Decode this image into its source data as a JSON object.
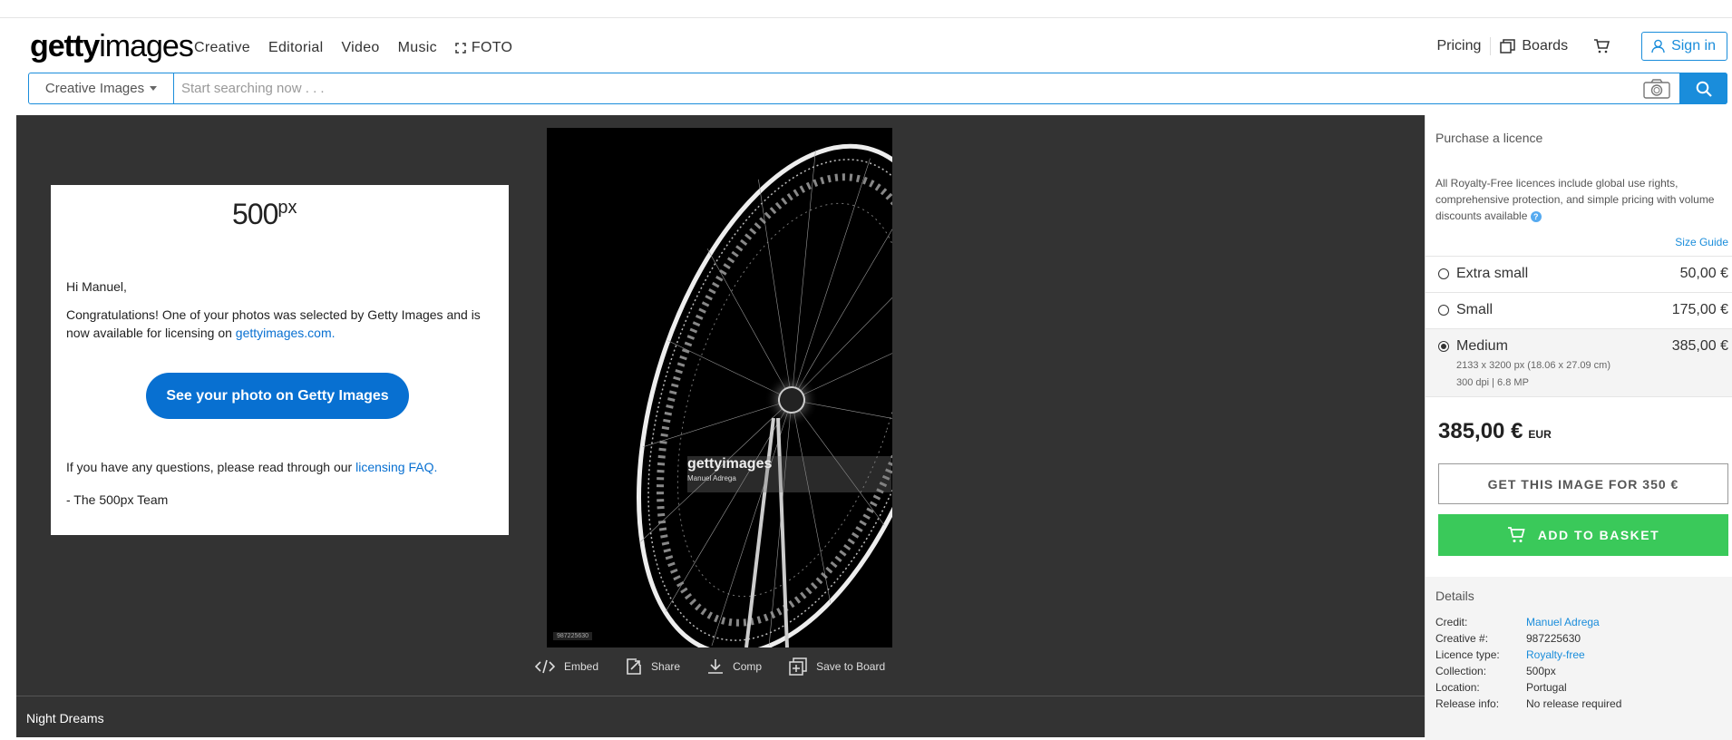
{
  "header": {
    "logo_bold": "getty",
    "logo_light": "images",
    "nav": [
      "Creative",
      "Editorial",
      "Video",
      "Music",
      "FOTO"
    ],
    "pricing": "Pricing",
    "boards": "Boards",
    "sign_in": "Sign in"
  },
  "search": {
    "type": "Creative Images",
    "placeholder": "Start searching now . . ."
  },
  "email": {
    "logo": "500",
    "logo_sup": "px",
    "greeting": "Hi Manuel,",
    "body_1": "Congratulations! One of your photos was selected by Getty Images and is now available for licensing on ",
    "body_link": "gettyimages.com.",
    "button": "See your photo on Getty Images",
    "questions": "If you have any questions, please read through our ",
    "questions_link": "licensing FAQ.",
    "signature": "- The 500px Team"
  },
  "photo": {
    "id": "987225630",
    "watermark_logo": "gettyimages",
    "watermark_name": "Manuel Adrega"
  },
  "actions": {
    "embed": "Embed",
    "share": "Share",
    "comp": "Comp",
    "save": "Save to Board"
  },
  "image_title": "Night Dreams",
  "sidebar": {
    "title": "Purchase a licence",
    "description": "All Royalty-Free licences include global use rights, comprehensive protection, and simple pricing with volume discounts available",
    "size_guide": "Size Guide",
    "sizes": [
      {
        "name": "Extra small",
        "price": "50,00 €"
      },
      {
        "name": "Small",
        "price": "175,00 €"
      },
      {
        "name": "Medium",
        "price": "385,00 €",
        "dims": "2133 x 3200 px (18.06 x 27.09 cm)",
        "res": "300 dpi | 6.8 MP"
      }
    ],
    "selected": "Medium",
    "total": "385,00 €",
    "currency": "EUR",
    "get_button": "GET THIS IMAGE FOR 350 €",
    "basket_button": "ADD TO BASKET"
  },
  "details": {
    "title": "Details",
    "rows": [
      {
        "k": "Credit:",
        "v": "Manuel Adrega"
      },
      {
        "k": "Creative #:",
        "v": "987225630"
      },
      {
        "k": "Licence type:",
        "v": "Royalty-free"
      },
      {
        "k": "Collection:",
        "v": "500px"
      },
      {
        "k": "Location:",
        "v": "Portugal"
      },
      {
        "k": "Release info:",
        "v": "No release required"
      }
    ]
  },
  "colors": {
    "accent": "#1a8ddb",
    "basket": "#3ac95a",
    "dark_bg": "#333333"
  }
}
